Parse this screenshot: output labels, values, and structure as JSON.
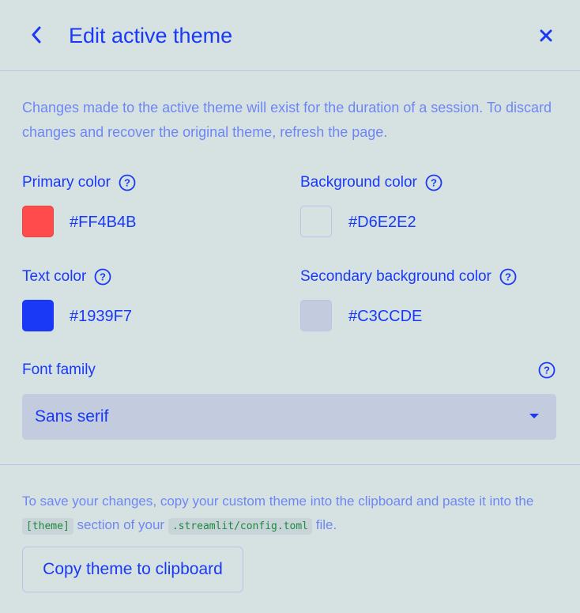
{
  "header": {
    "title": "Edit active theme",
    "back_icon": "chevron-left-icon",
    "close_icon": "close-icon"
  },
  "intro_text": "Changes made to the active theme will exist for the duration of a session. To discard changes and recover the original theme, refresh the page.",
  "colors": {
    "primary": {
      "label": "Primary color",
      "value": "#FF4B4B",
      "swatch": "#ff4b4b"
    },
    "background": {
      "label": "Background color",
      "value": "#D6E2E2",
      "swatch": "#d6e2e2"
    },
    "text": {
      "label": "Text color",
      "value": "#1939F7",
      "swatch": "#1939f7"
    },
    "secondary_background": {
      "label": "Secondary background color",
      "value": "#C3CCDE",
      "swatch": "#c3ccde"
    }
  },
  "font_family": {
    "label": "Font family",
    "value": "Sans serif"
  },
  "footer": {
    "text_before": "To save your changes, copy your custom theme into the clipboard and paste it into the ",
    "code_section": "[theme]",
    "text_middle": " section of your ",
    "code_file": ".streamlit/config.toml",
    "text_after": " file.",
    "copy_button_label": "Copy theme to clipboard"
  },
  "accent_color": "#1939f7",
  "muted_text_color": "#6e86f4"
}
